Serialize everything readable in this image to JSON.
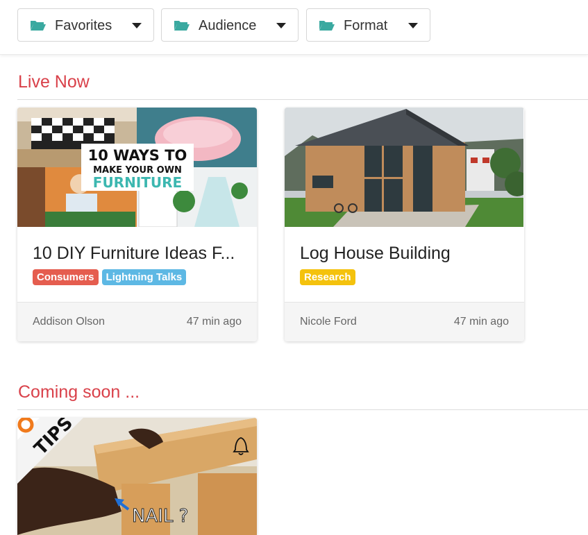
{
  "filters": [
    {
      "label": "Favorites"
    },
    {
      "label": "Audience"
    },
    {
      "label": "Format"
    }
  ],
  "sections": {
    "live_now": {
      "title": "Live Now"
    },
    "coming_soon": {
      "title": "Coming soon ..."
    }
  },
  "live_cards": [
    {
      "thumb_text_line1": "10 WAYS TO",
      "thumb_text_line2": "MAKE YOUR OWN",
      "thumb_text_line3": "FURNITURE",
      "title": "10 DIY Furniture Ideas F...",
      "tags": [
        {
          "label": "Consumers",
          "color": "#e55d4f"
        },
        {
          "label": "Lightning Talks",
          "color": "#5db8e4"
        }
      ],
      "author": "Addison Olson",
      "time": "47 min ago"
    },
    {
      "title": "Log House Building",
      "tags": [
        {
          "label": "Research",
          "color": "#f4c20d"
        }
      ],
      "author": "Nicole Ford",
      "time": "47 min ago"
    }
  ],
  "upcoming_cards": [
    {
      "thumb_badge": "TIPS",
      "thumb_caption": "NAIL ?"
    }
  ],
  "colors": {
    "accent": "#d9414a",
    "folder": "#3aa9a0"
  }
}
